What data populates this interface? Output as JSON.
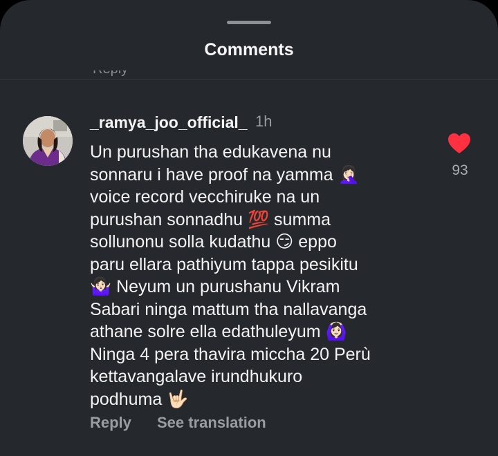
{
  "sheet": {
    "title": "Comments",
    "prev_text_fragment": "Reply"
  },
  "comment": {
    "username": "_ramya_joo_official_",
    "time": "1h",
    "lines": [
      "Un purushan tha edukavena nu",
      "sonnaru i have proof na yamma 🤦🏻‍♀️",
      "voice record vecchiruke na un",
      "purushan sonnadhu 💯 summa",
      "sollunonu solla kudathu 😏 eppo",
      "paru ellara pathiyum tappa pesikitu",
      "🤷🏻‍♀️ Neyum un purushanu Vikram",
      "Sabari ninga mattum tha nallavanga",
      "athane solre ella edathuleyum 🙆🏻‍♀️",
      "Ninga 4 pera thavira miccha 20 Perù",
      "kettavangalave irundhukuro",
      "podhuma 🤟🏻"
    ],
    "likes": "93",
    "reply_label": "Reply",
    "translate_label": "See translation"
  },
  "colors": {
    "background": "#25292e",
    "heart": "#ff3040",
    "muted_text": "#9a9da2"
  },
  "icons": {
    "like": "heart-icon",
    "avatar": "profile-photo"
  }
}
